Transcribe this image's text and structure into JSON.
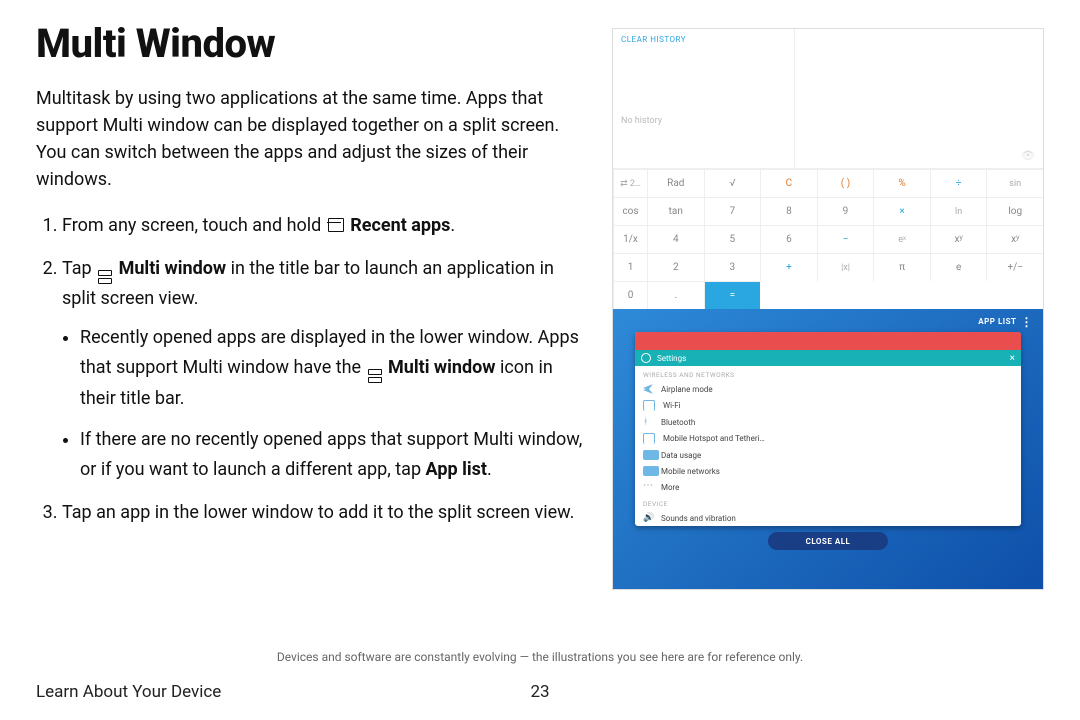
{
  "title": "Multi Window",
  "intro": "Multitask by using two applications at the same time. Apps that support Multi window can be displayed together on a split screen. You can switch between the apps and adjust the sizes of their windows.",
  "steps": {
    "s1_a": "From any screen, touch and hold ",
    "s1_b": "Recent apps",
    "s1_c": ".",
    "s2_a": "Tap ",
    "s2_b": "Multi window",
    "s2_c": " in the title bar to launch an application in split screen view.",
    "s2_bullets": {
      "b1_a": "Recently opened apps are displayed in the lower window. Apps that support Multi window have the ",
      "b1_b": "Multi window",
      "b1_c": " icon in their title bar.",
      "b2_a": "If there are no recently opened apps that support Multi window, or if you want to launch a different app, tap ",
      "b2_b": "App list",
      "b2_c": "."
    },
    "s3": "Tap an app in the lower window to add it to the split screen view."
  },
  "illus": {
    "clear_history": "CLEAR HISTORY",
    "no_history": "No history",
    "display_hint": "⦿",
    "keys": {
      "r1": [
        "⇄ 2…",
        "Rad",
        "√",
        "C",
        "( )",
        "%",
        "÷"
      ],
      "r2": [
        "sin",
        "cos",
        "tan",
        "7",
        "8",
        "9",
        "×"
      ],
      "r3": [
        "ln",
        "log",
        "1/x",
        "4",
        "5",
        "6",
        "−"
      ],
      "r4": [
        "eˣ",
        "xʸ",
        "xʸ",
        "1",
        "2",
        "3",
        "+"
      ],
      "r5": [
        "|x|",
        "π",
        "e",
        "+/−",
        "0",
        ".",
        "="
      ]
    },
    "app_list": "APP LIST",
    "settings": "Settings",
    "section1": "WIRELESS AND NETWORKS",
    "rows1": [
      "Airplane mode",
      "Wi-Fi",
      "Bluetooth",
      "Mobile Hotspot and Tetheri…",
      "Data usage",
      "Mobile networks",
      "More"
    ],
    "section2": "DEVICE",
    "rows2": [
      "Sounds and vibration"
    ],
    "close_all": "CLOSE ALL"
  },
  "footnote": "Devices and software are constantly evolving — the illustrations you see here are for reference only.",
  "footer": "Learn About Your Device",
  "page": "23"
}
